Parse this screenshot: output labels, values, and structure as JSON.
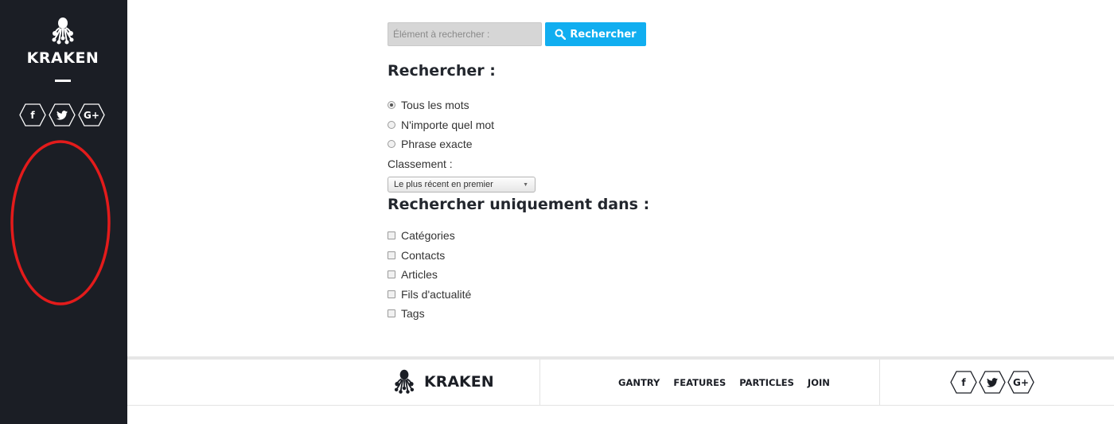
{
  "sidebar": {
    "brand": "KRAKEN",
    "social": [
      {
        "icon": "facebook-icon",
        "glyph": "f"
      },
      {
        "icon": "twitter-icon",
        "glyph": "🐦"
      },
      {
        "icon": "google-plus-icon",
        "glyph": "G+"
      }
    ],
    "annotation_color": "#e31b1b"
  },
  "search": {
    "placeholder": "Élément à rechercher :",
    "button_label": "Rechercher",
    "button_color": "#11aef0"
  },
  "options": {
    "heading": "Rechercher :",
    "match_modes": [
      "Tous les mots",
      "N'importe quel mot",
      "Phrase exacte"
    ],
    "selected_mode": "Tous les mots",
    "ordering_label": "Classement :",
    "ordering_value": "Le plus récent en premier"
  },
  "areas": {
    "heading": "Rechercher uniquement dans :",
    "items": [
      "Catégories",
      "Contacts",
      "Articles",
      "Fils d'actualité",
      "Tags"
    ]
  },
  "footer": {
    "brand": "KRAKEN",
    "nav": [
      "GANTRY",
      "FEATURES",
      "PARTICLES",
      "JOIN"
    ],
    "social": [
      {
        "icon": "facebook-icon",
        "glyph": "f"
      },
      {
        "icon": "twitter-icon",
        "glyph": "🐦"
      },
      {
        "icon": "google-plus-icon",
        "glyph": "G+"
      }
    ]
  }
}
